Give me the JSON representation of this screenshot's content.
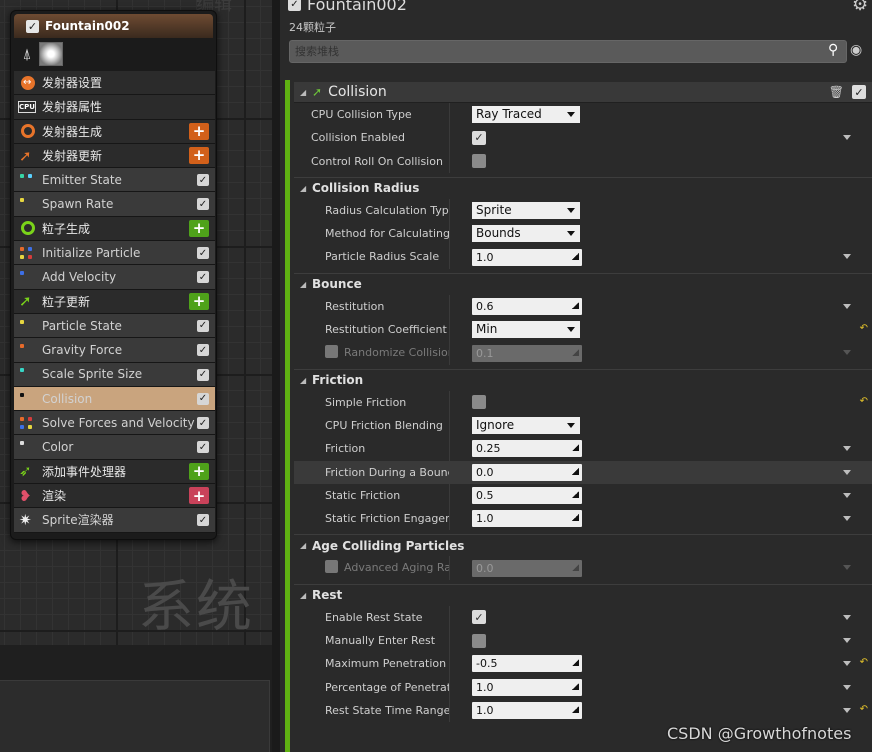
{
  "graph": {
    "top_text": "编辑",
    "watermark": "系统"
  },
  "node": {
    "title": "Fountain002",
    "rows": [
      {
        "kind": "section",
        "label": "发射器设置",
        "icon": "emitter-settings-icon",
        "color": "#e8742a"
      },
      {
        "kind": "section",
        "label": "发射器属性",
        "icon": "cpu-icon"
      },
      {
        "kind": "section",
        "label": "发射器生成",
        "icon": "emitter-spawn-icon",
        "color": "#e8742a",
        "plus": "#d2601a"
      },
      {
        "kind": "section",
        "label": "发射器更新",
        "icon": "emitter-update-icon",
        "color": "#e8742a",
        "plus": "#d2601a"
      },
      {
        "kind": "item",
        "label": "Emitter State",
        "dots": [
          "#37d6a6",
          "#5ad1ff"
        ]
      },
      {
        "kind": "item",
        "label": "Spawn Rate",
        "dots": [
          "#e6d640"
        ]
      },
      {
        "kind": "section",
        "label": "粒子生成",
        "icon": "particle-spawn-icon",
        "color": "#7ad31a",
        "plus": "#4fa21a"
      },
      {
        "kind": "item",
        "label": "Initialize Particle",
        "dots": [
          "#e66a2a",
          "#3d6fe6",
          "#e6d640",
          "#d63c3c"
        ]
      },
      {
        "kind": "item",
        "label": "Add Velocity",
        "dots": [
          "#3d6fe6"
        ]
      },
      {
        "kind": "section",
        "label": "粒子更新",
        "icon": "particle-update-icon",
        "color": "#7ad31a",
        "plus": "#4fa21a"
      },
      {
        "kind": "item",
        "label": "Particle State",
        "dots": [
          "#e6d640"
        ]
      },
      {
        "kind": "item",
        "label": "Gravity Force",
        "dots": [
          "#e66a2a"
        ]
      },
      {
        "kind": "item",
        "label": "Scale Sprite Size",
        "dots": [
          "#37d6c6"
        ]
      },
      {
        "kind": "item",
        "label": "Collision",
        "dots": [
          "#111111"
        ],
        "selected": true
      },
      {
        "kind": "item",
        "label": "Solve Forces and Velocity",
        "dots": [
          "#e66a2a",
          "#d63c3c",
          "#3d6fe6",
          "#e6d640"
        ]
      },
      {
        "kind": "item",
        "label": "Color",
        "dots": [
          "#dddddd"
        ]
      },
      {
        "kind": "section",
        "label": "添加事件处理器",
        "icon": "event-handler-icon",
        "color": "#7ad31a",
        "plus": "#4fa21a"
      },
      {
        "kind": "section",
        "label": "渲染",
        "icon": "render-icon",
        "color": "#e0506a",
        "plus": "#c9425a"
      },
      {
        "kind": "item",
        "label": "Sprite渲染器",
        "icon": "sprite-renderer-icon"
      }
    ]
  },
  "details": {
    "title": "Fountain002",
    "count": "24颗粒子",
    "search_placeholder": "搜索堆栈",
    "module_title": "Collision",
    "rows": [
      {
        "type": "prop",
        "label": "CPU Collision Type",
        "indent": 1,
        "select": "Ray Traced"
      },
      {
        "type": "prop",
        "label": "Collision Enabled",
        "indent": 1,
        "checkbox": true,
        "caret": true
      },
      {
        "type": "prop",
        "label": "Control Roll On Collision",
        "indent": 1,
        "checkbox": false
      },
      {
        "type": "cat",
        "label": "Collision Radius"
      },
      {
        "type": "prop",
        "label": "Radius Calculation Type",
        "indent": 2,
        "select": "Sprite"
      },
      {
        "type": "prop",
        "label": "Method for Calculating Particle Radius",
        "indent": 2,
        "select": "Bounds"
      },
      {
        "type": "prop",
        "label": "Particle Radius Scale",
        "indent": 2,
        "input": "1.0",
        "caret": true
      },
      {
        "type": "cat",
        "label": "Bounce"
      },
      {
        "type": "prop",
        "label": "Restitution",
        "indent": 2,
        "input": "0.6",
        "caret": true
      },
      {
        "type": "prop",
        "label": "Restitution Coefficient Blend",
        "indent": 2,
        "select": "Min",
        "reset": true
      },
      {
        "type": "prop",
        "label": "Randomize Collision Normal",
        "indent": 2,
        "input": "0.1",
        "disabled": true,
        "inline_cb": true,
        "caret": true
      },
      {
        "type": "cat",
        "label": "Friction"
      },
      {
        "type": "prop",
        "label": "Simple Friction",
        "indent": 2,
        "checkbox": false,
        "reset": true
      },
      {
        "type": "prop",
        "label": "CPU Friction Blending",
        "indent": 2,
        "select": "Ignore"
      },
      {
        "type": "prop",
        "label": "Friction",
        "indent": 2,
        "input": "0.25",
        "caret": true
      },
      {
        "type": "prop",
        "label": "Friction During a Bounce",
        "indent": 2,
        "input": "0.0",
        "caret": true,
        "highlight": true
      },
      {
        "type": "prop",
        "label": "Static Friction",
        "indent": 2,
        "input": "0.5",
        "caret": true
      },
      {
        "type": "prop",
        "label": "Static Friction Engagement",
        "indent": 2,
        "input": "1.0",
        "caret": true
      },
      {
        "type": "cat",
        "label": "Age Colliding Particles"
      },
      {
        "type": "prop",
        "label": "Advanced Aging Rate",
        "indent": 2,
        "input": "0.0",
        "disabled": true,
        "inline_cb": true,
        "caret": true
      },
      {
        "type": "cat",
        "label": "Rest"
      },
      {
        "type": "prop",
        "label": "Enable Rest State",
        "indent": 2,
        "checkbox": true,
        "caret": true
      },
      {
        "type": "prop",
        "label": "Manually Enter Rest",
        "indent": 2,
        "checkbox": false,
        "caret": true
      },
      {
        "type": "prop",
        "label": "Maximum Penetration Correction",
        "indent": 2,
        "input": "-0.5",
        "caret": true,
        "reset": true
      },
      {
        "type": "prop",
        "label": "Percentage of Penetration Escape",
        "indent": 2,
        "input": "1.0",
        "caret": true
      },
      {
        "type": "prop",
        "label": "Rest State Time Range",
        "indent": 2,
        "input": "1.0",
        "caret": true,
        "reset": true
      }
    ]
  },
  "watermark": "CSDN @Growthofnotes"
}
